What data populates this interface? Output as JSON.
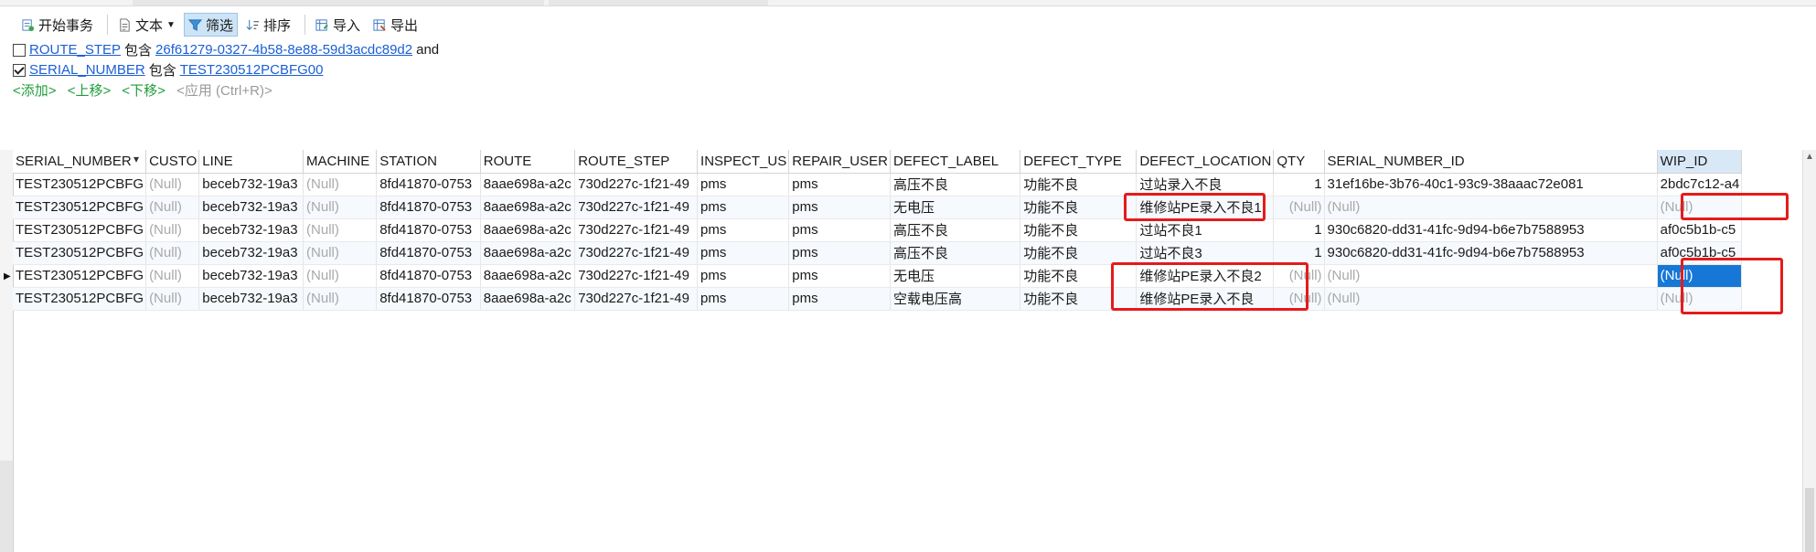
{
  "toolbar": {
    "begin_tx": "开始事务",
    "text": "文本",
    "filter": "筛选",
    "sort": "排序",
    "import": "导入",
    "export": "导出"
  },
  "filters": [
    {
      "checked": false,
      "field": "ROUTE_STEP",
      "op": "包含",
      "value": "26f61279-0327-4b58-8e88-59d3acdc89d2",
      "tail": "and"
    },
    {
      "checked": true,
      "field": "SERIAL_NUMBER",
      "op": "包含",
      "value": "TEST230512PCBFG00",
      "tail": ""
    }
  ],
  "actions": {
    "add": "<添加>",
    "up": "<上移>",
    "down": "<下移>",
    "apply": "<应用 (Ctrl+R)>"
  },
  "grid": {
    "columns": [
      "SERIAL_NUMBER",
      "CUSTO",
      "LINE",
      "MACHINE",
      "STATION",
      "ROUTE",
      "ROUTE_STEP",
      "INSPECT_US",
      "REPAIR_USER",
      "DEFECT_LABEL",
      "DEFECT_TYPE",
      "DEFECT_LOCATION",
      "QTY",
      "SERIAL_NUMBER_ID",
      "",
      "WIP_ID"
    ],
    "rows": [
      [
        "TEST230512PCBFG",
        "(Null)",
        "beceb732-19a3",
        "(Null)",
        "8fd41870-0753",
        "8aae698a-a2c",
        "730d227c-1f21-49",
        "pms",
        "pms",
        "高压不良",
        "功能不良",
        "过站录入不良",
        "1",
        "31ef16be-3b76-40c1-93c9-38aaac72e081",
        "",
        "2bdc7c12-a4"
      ],
      [
        "TEST230512PCBFG",
        "(Null)",
        "beceb732-19a3",
        "(Null)",
        "8fd41870-0753",
        "8aae698a-a2c",
        "730d227c-1f21-49",
        "pms",
        "pms",
        "无电压",
        "功能不良",
        "维修站PE录入不良1",
        "(Null)",
        "(Null)",
        "",
        "(Null)"
      ],
      [
        "TEST230512PCBFG",
        "(Null)",
        "beceb732-19a3",
        "(Null)",
        "8fd41870-0753",
        "8aae698a-a2c",
        "730d227c-1f21-49",
        "pms",
        "pms",
        "高压不良",
        "功能不良",
        "过站不良1",
        "1",
        "930c6820-dd31-41fc-9d94-b6e7b7588953",
        "",
        "af0c5b1b-c5"
      ],
      [
        "TEST230512PCBFG",
        "(Null)",
        "beceb732-19a3",
        "(Null)",
        "8fd41870-0753",
        "8aae698a-a2c",
        "730d227c-1f21-49",
        "pms",
        "pms",
        "高压不良",
        "功能不良",
        "过站不良3",
        "1",
        "930c6820-dd31-41fc-9d94-b6e7b7588953",
        "",
        "af0c5b1b-c5"
      ],
      [
        "TEST230512PCBFG",
        "(Null)",
        "beceb732-19a3",
        "(Null)",
        "8fd41870-0753",
        "8aae698a-a2c",
        "730d227c-1f21-49",
        "pms",
        "pms",
        "无电压",
        "功能不良",
        "维修站PE录入不良2",
        "(Null)",
        "(Null)",
        "",
        "(Null)"
      ],
      [
        "TEST230512PCBFG",
        "(Null)",
        "beceb732-19a3",
        "(Null)",
        "8fd41870-0753",
        "8aae698a-a2c",
        "730d227c-1f21-49",
        "pms",
        "pms",
        "空载电压高",
        "功能不良",
        "维修站PE录入不良",
        "(Null)",
        "(Null)",
        "",
        "(Null)"
      ]
    ],
    "current_row": 4,
    "selected_column": 15
  },
  "colors": {
    "highlight": "#e51b1b",
    "selected_cell": "#1677d6",
    "link": "#1a5fd6",
    "action": "#1f9d3a"
  }
}
